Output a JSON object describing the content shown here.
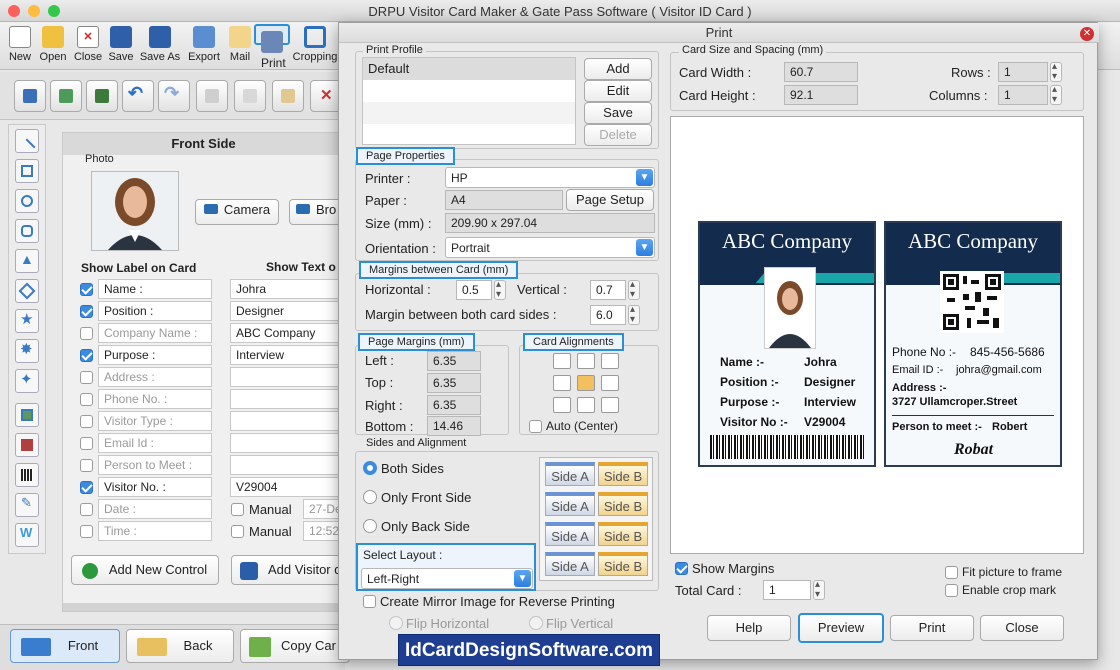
{
  "app": {
    "title": "DRPU Visitor Card Maker & Gate Pass Software ( Visitor ID Card )"
  },
  "toolbar": {
    "items": [
      "New",
      "Open",
      "Close",
      "Save",
      "Save As",
      "Export",
      "Mail",
      "Print",
      "Cropping"
    ]
  },
  "editor": {
    "front_side": "Front Side",
    "photo_label": "Photo",
    "camera_label": "Camera",
    "browse_label": "Bro",
    "show_label_header": "Show Label on Card",
    "show_text_header": "Show Text o",
    "rows": [
      {
        "label": "Name :",
        "value": "Johra",
        "checked": true
      },
      {
        "label": "Position :",
        "value": "Designer",
        "checked": true
      },
      {
        "label": "Company Name :",
        "value": "ABC Company",
        "checked": false
      },
      {
        "label": "Purpose :",
        "value": "Interview",
        "checked": true
      },
      {
        "label": "Address :",
        "value": "",
        "checked": false
      },
      {
        "label": "Phone No. :",
        "value": "",
        "checked": false
      },
      {
        "label": "Visitor Type :",
        "value": "",
        "checked": false
      },
      {
        "label": "Email Id :",
        "value": "",
        "checked": false
      },
      {
        "label": "Person to Meet :",
        "value": "",
        "checked": false
      },
      {
        "label": "Visitor No. :",
        "value": "V29004",
        "checked": true
      },
      {
        "label": "Date :",
        "value": "",
        "checked": false
      },
      {
        "label": "Time :",
        "value": "",
        "checked": false
      }
    ],
    "manual_label": "Manual",
    "date_value": "27-De",
    "time_value": "12:52",
    "add_new_control": "Add New Control",
    "add_visitor": "Add Visitor d"
  },
  "bottom": {
    "front": "Front",
    "back": "Back",
    "copy": "Copy Car"
  },
  "print": {
    "title": "Print",
    "print_profile": {
      "title": "Print Profile",
      "selected": "Default",
      "add": "Add",
      "edit": "Edit",
      "save": "Save",
      "delete": "Delete"
    },
    "card_size": {
      "title": "Card Size and Spacing (mm)",
      "width_label": "Card Width :",
      "width": "60.7",
      "height_label": "Card Height :",
      "height": "92.1",
      "rows_label": "Rows :",
      "rows": "1",
      "columns_label": "Columns :",
      "columns": "1"
    },
    "page_properties": {
      "title": "Page Properties",
      "printer_label": "Printer :",
      "printer": "HP",
      "paper_label": "Paper :",
      "paper": "A4",
      "page_setup": "Page Setup",
      "size_label": "Size (mm) :",
      "size": "209.90 x 297.04",
      "orientation_label": "Orientation :",
      "orientation": "Portrait"
    },
    "margins_between": {
      "title": "Margins between Card (mm)",
      "horizontal_label": "Horizontal :",
      "horizontal": "0.5",
      "vertical_label": "Vertical :",
      "vertical": "0.7",
      "both_label": "Margin between both card sides :",
      "both": "6.0"
    },
    "page_margins": {
      "title": "Page Margins (mm)",
      "left_label": "Left :",
      "left": "6.35",
      "top_label": "Top :",
      "top": "6.35",
      "right_label": "Right :",
      "right": "6.35",
      "bottom_label": "Bottom :",
      "bottom": "14.46"
    },
    "card_alignments": {
      "title": "Card Alignments",
      "auto_center": "Auto (Center)"
    },
    "sides": {
      "title": "Sides and Alignment",
      "both": "Both Sides",
      "front_only": "Only Front Side",
      "back_only": "Only Back Side",
      "side_a": "Side A",
      "side_b": "Side B"
    },
    "layout": {
      "label": "Select Layout :",
      "value": "Left-Right"
    },
    "mirror": {
      "label": "Create Mirror Image for Reverse Printing",
      "flip_h": "Flip Horizontal",
      "flip_v": "Flip Vertical"
    },
    "options": {
      "show_margins": "Show Margins",
      "fit_picture": "Fit picture to frame",
      "enable_crop": "Enable crop mark",
      "total_card_label": "Total Card :",
      "total_card": "1"
    },
    "buttons": {
      "help": "Help",
      "preview": "Preview",
      "print": "Print",
      "close": "Close"
    }
  },
  "card_front": {
    "company": "ABC Company",
    "fields": [
      [
        "Name :-",
        "Johra"
      ],
      [
        "Position :-",
        "Designer"
      ],
      [
        "Purpose :-",
        "Interview"
      ],
      [
        "Visitor No :-",
        "V29004"
      ]
    ]
  },
  "card_back": {
    "company": "ABC Company",
    "phone_label": "Phone No :-",
    "phone": "845-456-5686",
    "email_label": "Email ID :-",
    "email": "johra@gmail.com",
    "address_label": "Address :-",
    "address": "3727 Ullamcroper.Street",
    "person_label": "Person to meet :-",
    "person": "Robert",
    "signature": "Robat"
  },
  "watermark": "IdCardDesignSoftware.com"
}
